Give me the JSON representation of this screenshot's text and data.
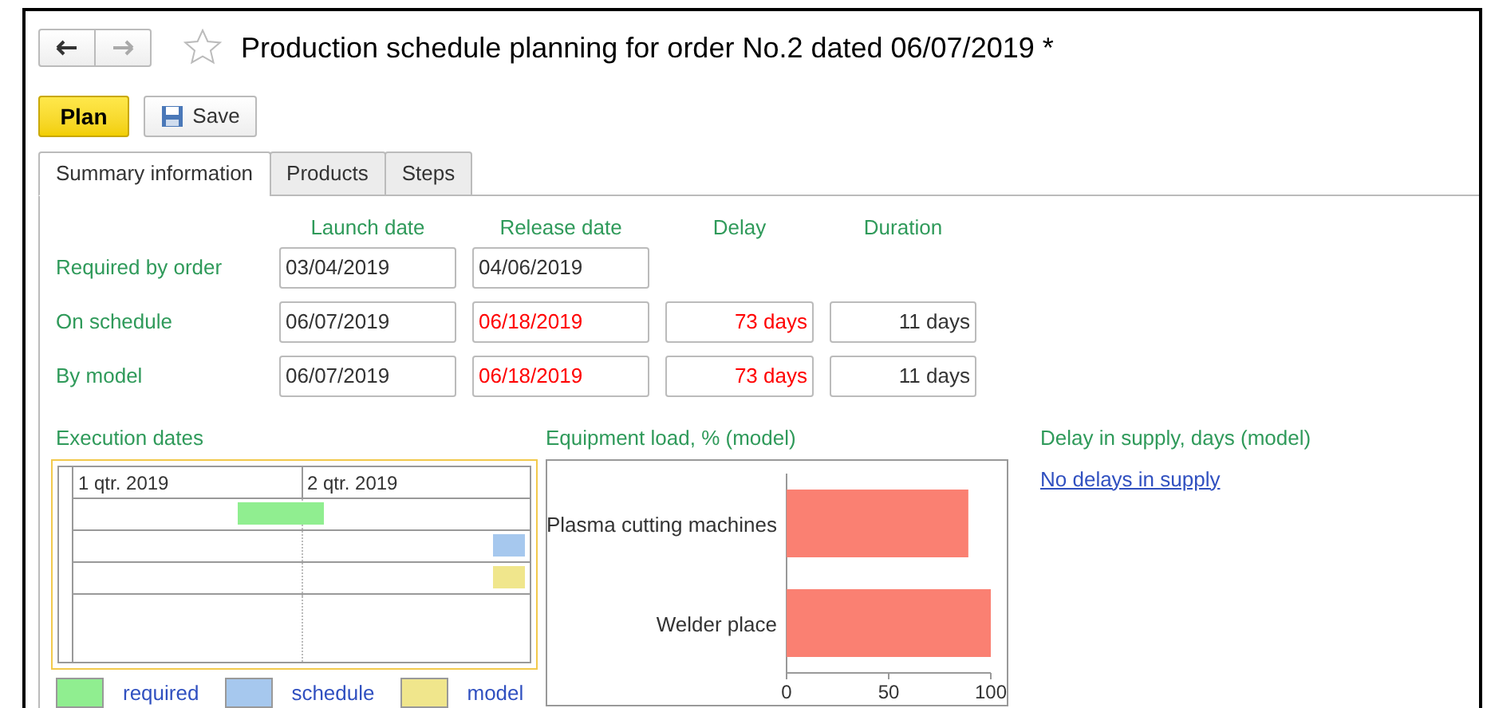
{
  "window": {
    "title": "Production schedule planning for order No.2 dated 06/07/2019 *",
    "favorite": false
  },
  "toolbar": {
    "primary_button": "Plan",
    "save_button": "Save"
  },
  "tabs": [
    {
      "label": "Summary information",
      "selected": true
    },
    {
      "label": "Products",
      "selected": false
    },
    {
      "label": "Steps",
      "selected": false
    }
  ],
  "dates_table": {
    "columns": [
      "Launch date",
      "Release date",
      "Delay",
      "Duration"
    ],
    "rows": [
      {
        "label": "Required by order",
        "cells": [
          {
            "value": "03/04/2019",
            "late": false
          },
          {
            "value": "04/06/2019",
            "late": false
          }
        ]
      },
      {
        "label": "On schedule",
        "cells": [
          {
            "value": "06/07/2019",
            "late": false
          },
          {
            "value": "06/18/2019",
            "late": true
          },
          {
            "value": "73 days",
            "late": true
          },
          {
            "value": "11 days",
            "late": false
          }
        ]
      },
      {
        "label": "By model",
        "cells": [
          {
            "value": "06/07/2019",
            "late": false
          },
          {
            "value": "06/18/2019",
            "late": true
          },
          {
            "value": "73 days",
            "late": true
          },
          {
            "value": "11 days",
            "late": false
          }
        ]
      }
    ]
  },
  "execution_dates": {
    "title": "Execution dates",
    "periods": [
      "1 qtr. 2019",
      "2 qtr. 2019"
    ],
    "legend": [
      {
        "label": "required",
        "color": "#90ee90"
      },
      {
        "label": "schedule",
        "color": "#a6c8ee"
      },
      {
        "label": "model",
        "color": "#f0e68c"
      }
    ]
  },
  "equipment_load": {
    "title": "Equipment load, % (model)",
    "chart_data": {
      "type": "bar",
      "orientation": "horizontal",
      "categories": [
        "Plasma cutting machines",
        "Welder place"
      ],
      "series": [
        {
          "color": "#fa8072",
          "values": [
            89,
            100
          ]
        }
      ],
      "xlim": [
        0,
        100
      ],
      "xticks": [
        0,
        50,
        100
      ]
    }
  },
  "supply_delay": {
    "title": "Delay in supply, days (model)",
    "link": "No delays in supply"
  }
}
